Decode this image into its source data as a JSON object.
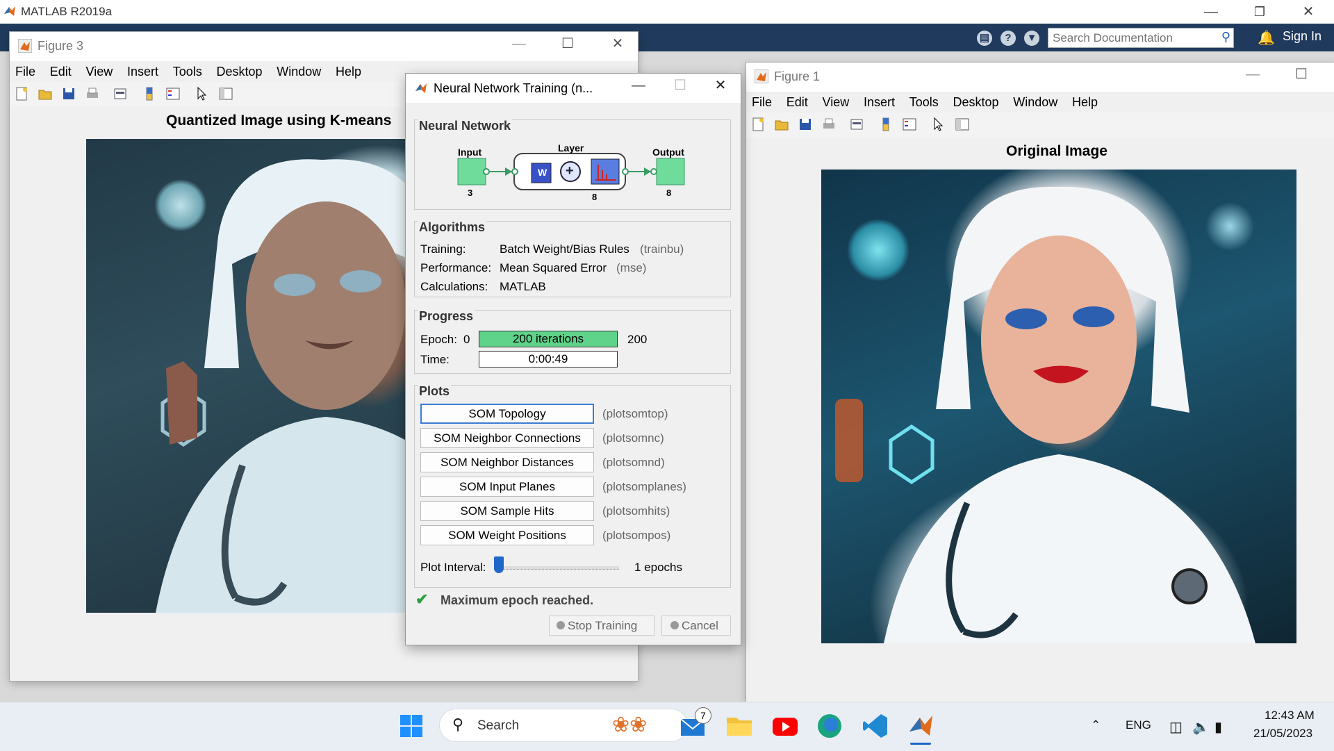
{
  "app": {
    "title": "MATLAB R2019a"
  },
  "toolstrip": {
    "search_placeholder": "Search Documentation",
    "sign_in": "Sign In"
  },
  "figure3": {
    "title": "Figure 3",
    "menu": [
      "File",
      "Edit",
      "View",
      "Insert",
      "Tools",
      "Desktop",
      "Window",
      "Help"
    ],
    "plot_title": "Quantized Image using K-means"
  },
  "figure1": {
    "title": "Figure 1",
    "menu": [
      "File",
      "Edit",
      "View",
      "Insert",
      "Tools",
      "Desktop",
      "Window",
      "Help"
    ],
    "plot_title": "Original Image"
  },
  "nn_training": {
    "title": "Neural Network Training (n...",
    "network": {
      "section": "Neural Network",
      "input_label": "Input",
      "input_size": "3",
      "layer_label": "Layer",
      "layer_size": "8",
      "output_label": "Output",
      "output_size": "8",
      "weight_glyph": "W",
      "sum_glyph": "+"
    },
    "algorithms": {
      "section": "Algorithms",
      "rows": [
        {
          "label": "Training:",
          "value": "Batch Weight/Bias Rules",
          "note": "(trainbu)"
        },
        {
          "label": "Performance:",
          "value": "Mean Squared Error",
          "note": "(mse)"
        },
        {
          "label": "Calculations:",
          "value": "MATLAB",
          "note": ""
        }
      ]
    },
    "progress": {
      "section": "Progress",
      "epoch_label": "Epoch:",
      "epoch_start": "0",
      "epoch_text": "200 iterations",
      "epoch_end": "200",
      "epoch_fraction": 1.0,
      "time_label": "Time:",
      "time_value": "0:00:49"
    },
    "plots": {
      "section": "Plots",
      "buttons": [
        {
          "label": "SOM Topology",
          "fn": "(plotsomtop)"
        },
        {
          "label": "SOM Neighbor Connections",
          "fn": "(plotsomnc)"
        },
        {
          "label": "SOM Neighbor Distances",
          "fn": "(plotsomnd)"
        },
        {
          "label": "SOM Input Planes",
          "fn": "(plotsomplanes)"
        },
        {
          "label": "SOM Sample Hits",
          "fn": "(plotsomhits)"
        },
        {
          "label": "SOM Weight Positions",
          "fn": "(plotsompos)"
        }
      ],
      "interval_label": "Plot Interval:",
      "interval_value": "1 epochs"
    },
    "status": "Maximum epoch reached.",
    "stop_button": "Stop Training",
    "cancel_button": "Cancel"
  },
  "taskbar": {
    "search_label": "Search",
    "mail_badge": "7",
    "language": "ENG",
    "time": "12:43 AM",
    "date": "21/05/2023"
  },
  "colors": {
    "toolstrip": "#1f3a5c",
    "progress_fill": "#5fd38a",
    "node_green": "#6fdc9c",
    "accent_blue": "#3d7bd3"
  }
}
